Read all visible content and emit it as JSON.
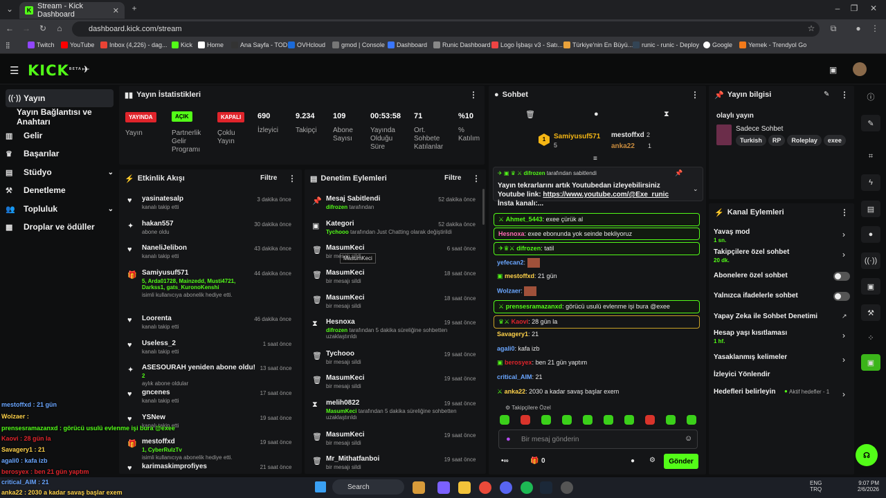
{
  "browser": {
    "tab_title": "Stream - Kick Dashboard",
    "url": "dashboard.kick.com/stream",
    "bookmarks": [
      "Twitch",
      "YouTube",
      "Inbox (4,226) - dag...",
      "Kick",
      "Home",
      "Ana Sayfa - TOD",
      "OVHcloud",
      "gmod | Console",
      "Dashboard",
      "Runic Dashboard",
      "Logo İşbaşı v3 - Satı...",
      "Türkiye'nin En Büyü...",
      "runic - runic - Deploy",
      "Google",
      "Yemek - Trendyol Go"
    ]
  },
  "header": {
    "logo": "KICK",
    "beta": "BETA"
  },
  "sidebar": [
    "Yayın",
    "Yayın Bağlantısı ve Anahtarı",
    "Gelir",
    "Başarılar",
    "Stüdyo",
    "Denetleme",
    "Topluluk",
    "Droplar ve ödüller"
  ],
  "stats": {
    "title": "Yayın İstatistikleri",
    "badges": [
      {
        "label": "YAYINDA",
        "sub": "Yayın"
      },
      {
        "label": "AÇIK",
        "sub": "Partnerlik Gelir Programı"
      },
      {
        "label": "KAPALI",
        "sub": "Çoklu Yayın"
      }
    ],
    "values": [
      {
        "v": "690",
        "l": "İzleyici"
      },
      {
        "v": "9.234",
        "l": "Takipçi"
      },
      {
        "v": "109",
        "l": "Abone Sayısı"
      },
      {
        "v": "00:53:58",
        "l": "Yayında Olduğu Süre"
      },
      {
        "v": "71",
        "l": "Ort. Sohbete Katılanlar"
      },
      {
        "v": "%10",
        "l": "% Katılım"
      }
    ]
  },
  "activity": {
    "title": "Etkinlik Akışı",
    "filter": "Filtre",
    "items": [
      {
        "t": "yasinatesalp",
        "s": "kanalı takip etti",
        "time": "3 dakika önce"
      },
      {
        "t": "hakan557",
        "s": "abone oldu",
        "time": "30 dakika önce"
      },
      {
        "t": "NaneliJelibon",
        "s": "kanalı takip etti",
        "time": "43 dakika önce"
      },
      {
        "t": "Samiyusuf571",
        "g": "5, Arda01728, Mainzedd, Musti4721, Darkss1, gats_KuronoKenshi",
        "s": "isimli kullanıcıya abonelik hediye etti.",
        "time": "44 dakika önce"
      },
      {
        "t": "Loorenta",
        "s": "kanalı takip etti",
        "time": "46 dakika önce"
      },
      {
        "t": "Useless_2",
        "s": "kanalı takip etti",
        "time": "1 saat önce"
      },
      {
        "t": "ASESOURAH yeniden abone oldu!",
        "g": "2",
        "s": "aylık abone oldular",
        "time": "13 saat önce"
      },
      {
        "t": "gncenes",
        "s": "kanalı takip etti",
        "time": "17 saat önce"
      },
      {
        "t": "YSNew",
        "s": "kanalı takip etti",
        "time": "19 saat önce"
      },
      {
        "t": "mestoffxd",
        "g": "1, CyberRulzTv",
        "s": "isimli kullanıcıya abonelik hediye etti.",
        "time": "19 saat önce"
      },
      {
        "t": "karimaskimprofiyes",
        "s": "",
        "time": "21 saat önce"
      }
    ]
  },
  "moderation": {
    "title": "Denetim Eylemleri",
    "filter": "Filtre",
    "tooltip": "MasumKeci",
    "items": [
      {
        "t": "Mesaj Sabitlendi",
        "g": "difrozen",
        "s": "tarafından",
        "time": "52 dakika önce"
      },
      {
        "t": "Kategori",
        "g": "Tychooo",
        "s": "tarafından Just Chatting olarak değiştirildi",
        "time": "52 dakika önce"
      },
      {
        "t": "MasumKeci",
        "s": "bir mesajı sildi",
        "time": "6 saat önce"
      },
      {
        "t": "MasumKeci",
        "s": "bir mesajı sildi",
        "time": "18 saat önce"
      },
      {
        "t": "MasumKeci",
        "s": "bir mesajı sildi",
        "time": "18 saat önce"
      },
      {
        "t": "Hesnoxa",
        "g": "difrozen",
        "s": "tarafından 5 dakika süreliğine sohbetten uzaklaştırıldı",
        "time": "19 saat önce"
      },
      {
        "t": "Tychooo",
        "s": "bir mesajı sildi",
        "time": "19 saat önce"
      },
      {
        "t": "MasumKeci",
        "s": "bir mesajı sildi",
        "time": "19 saat önce"
      },
      {
        "t": "melih0822",
        "g": "MasumKeci",
        "s": "tarafından 5 dakika süreliğine sohbetten uzaklaştırıldı",
        "time": "19 saat önce"
      },
      {
        "t": "MasumKeci",
        "s": "bir mesajı sildi",
        "time": "19 saat önce"
      },
      {
        "t": "Mr_Mithatfanboi",
        "s": "bir mesajı sildi",
        "time": "19 saat önce"
      }
    ]
  },
  "chat": {
    "title": "Sohbet",
    "lb": [
      {
        "n": "Samiyusuf571",
        "c": "5"
      },
      {
        "n": "mestoffxd",
        "c": "2"
      },
      {
        "n": "anka22",
        "c": "1"
      }
    ],
    "pinned": {
      "by": "difrozen",
      "label": "tarafından sabitlendi",
      "text": "Yayın tekrarlarını artık Youtubedan izleyebilirsiniz Youtube link:",
      "link": "https://www.youtube.com/@Exe_runic",
      "rest": "İnsta kanalı:..."
    },
    "messages": [
      {
        "n": "Ahmet_5443",
        "m": "exee çürük al"
      },
      {
        "n": "Hesnoxa",
        "m": "exee ebonunda yok seinde bekliyoruz"
      },
      {
        "n": "difrozen",
        "m": "tatil"
      },
      {
        "n": "yefecan2",
        "m": ""
      },
      {
        "n": "mestoffxd",
        "m": "21 gün"
      },
      {
        "n": "Wolzaer",
        "m": ""
      },
      {
        "n": "prensesramazanxd",
        "m": "görücü usulü evlenme işi bura @exee"
      },
      {
        "n": "Kaovi",
        "m": "28 gün la"
      },
      {
        "n": "Savagery1",
        "m": "21"
      },
      {
        "n": "agali0",
        "m": "kafa izb"
      },
      {
        "n": "berosyex",
        "m": "ben 21 gün yaptım"
      },
      {
        "n": "critical_AIM",
        "m": "21"
      },
      {
        "n": "anka22",
        "m": "2030 a kadar savaş başlar exem"
      }
    ],
    "followers_only": "Takipçilere Özel",
    "placeholder": "Bir mesaj gönderin",
    "send": "Gönder",
    "count": "0"
  },
  "info": {
    "title": "Yayın bilgisi",
    "stream_title": "olaylı yayın",
    "category": "Sadece Sohbet",
    "tags": [
      "Turkish",
      "RP",
      "Roleplay",
      "exee"
    ]
  },
  "actions": {
    "title": "Kanal Eylemleri",
    "items": [
      {
        "t": "Yavaş mod",
        "s": "1 sn."
      },
      {
        "t": "Takipçilere özel sohbet",
        "s": "20 dk."
      },
      {
        "t": "Abonelere özel sohbet",
        "s": ""
      },
      {
        "t": "Yalnızca ifadelerle sohbet",
        "s": ""
      },
      {
        "t": "Yapay Zeka ile Sohbet Denetimi",
        "s": ""
      },
      {
        "t": "Hesap yaşı kısıtlaması",
        "s": "1 hf."
      },
      {
        "t": "Yasaklanmış kelimeler",
        "s": ""
      },
      {
        "t": "İzleyici Yönlendir",
        "s": ""
      },
      {
        "t": "Hedefleri belirleyin",
        "s": "Aktif hedefler - 1"
      }
    ]
  },
  "overlay": [
    "mestoffxd : 21 gün",
    "Wolzaer :",
    "prensesramazanxd : görücü usulü evlenme işi bura @exee",
    "Kaovi : 28 gün la",
    "Savagery1 : 21",
    "agali0 : kafa izb",
    "berosyex : ben 21 gün yaptım",
    "critical_AIM : 21",
    "anka22 : 2030 a kadar savaş başlar exem"
  ],
  "taskbar": {
    "search": "Search",
    "lang": "ENG",
    "lang2": "TRQ",
    "time": "9:07 PM",
    "date": "2/6/2026"
  }
}
